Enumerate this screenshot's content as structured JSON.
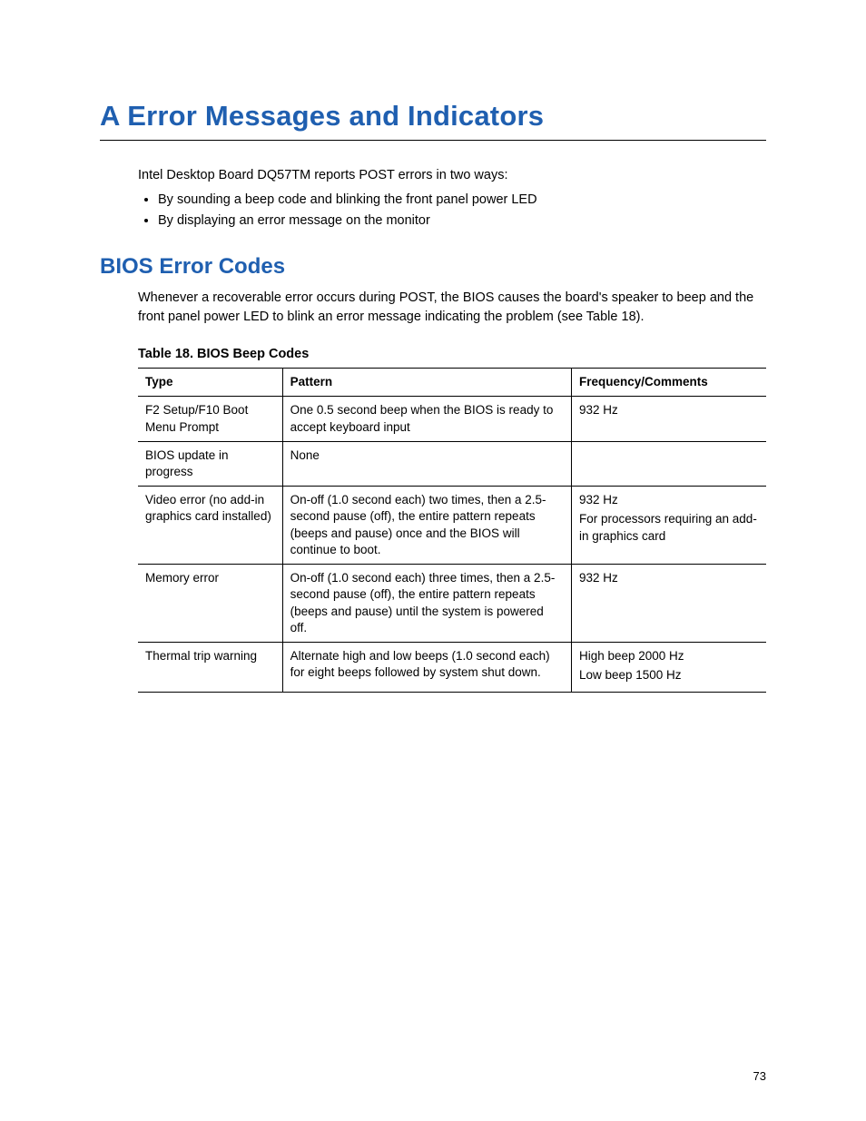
{
  "heading": {
    "prefix": "A",
    "title": "Error Messages and Indicators"
  },
  "intro": {
    "para": "Intel Desktop Board DQ57TM reports POST errors in two ways:",
    "bullets": [
      "By sounding a beep code and blinking the front panel power LED",
      "By displaying an error message on the monitor"
    ]
  },
  "section": {
    "title": "BIOS Error Codes",
    "para": "Whenever a recoverable error occurs during POST, the BIOS causes the board's speaker to beep and the front panel power LED to blink an error message indicating the problem (see Table 18)."
  },
  "table": {
    "caption": "Table 18. BIOS Beep Codes",
    "headers": {
      "type": "Type",
      "pattern": "Pattern",
      "freq": "Frequency/Comments"
    },
    "rows": [
      {
        "type": "F2 Setup/F10 Boot Menu Prompt",
        "pattern": "One 0.5 second beep when the BIOS is ready to accept keyboard input",
        "freq": "932 Hz"
      },
      {
        "type": "BIOS update in progress",
        "pattern": "None",
        "freq": ""
      },
      {
        "type": "Video error (no add-in graphics card installed)",
        "pattern": "On-off (1.0 second each) two times, then a 2.5-second pause (off), the entire pattern repeats (beeps and pause) once and the BIOS will continue to boot.",
        "freq": "932 Hz\nFor processors requiring an add-in graphics card"
      },
      {
        "type": "Memory error",
        "pattern": "On-off (1.0 second each) three times, then a 2.5-second pause (off), the entire pattern repeats (beeps and pause) until the system is powered off.",
        "freq": "932 Hz"
      },
      {
        "type": "Thermal trip warning",
        "pattern": "Alternate high and low beeps (1.0 second each) for eight beeps followed by system shut down.",
        "freq": "High beep 2000 Hz\nLow beep 1500 Hz"
      }
    ]
  },
  "page_number": "73"
}
